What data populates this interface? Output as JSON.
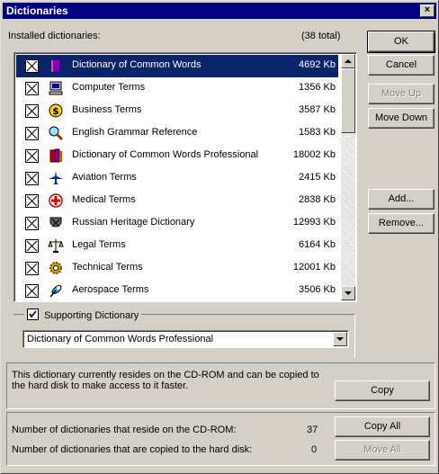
{
  "window": {
    "title": "Dictionaries",
    "close_label": "×"
  },
  "header": {
    "installed_label": "Installed dictionaries:",
    "total": "(38 total)"
  },
  "dictionaries": [
    {
      "name": "Dictionary of Common Words",
      "size": "4692 Kb",
      "icon": "book-icon",
      "checked": true,
      "selected": true
    },
    {
      "name": "Computer Terms",
      "size": "1356 Kb",
      "icon": "computer-icon",
      "checked": true
    },
    {
      "name": "Business Terms",
      "size": "3587 Kb",
      "icon": "dollar-icon",
      "checked": true
    },
    {
      "name": "English Grammar Reference",
      "size": "1583 Kb",
      "icon": "magnifier-icon",
      "checked": true
    },
    {
      "name": "Dictionary of Common Words Professional",
      "size": "18002 Kb",
      "icon": "books-icon",
      "checked": true
    },
    {
      "name": "Aviation Terms",
      "size": "2415 Kb",
      "icon": "airplane-icon",
      "checked": true
    },
    {
      "name": "Medical Terms",
      "size": "2838 Kb",
      "icon": "medical-cross-icon",
      "checked": true
    },
    {
      "name": "Russian Heritage Dictionary",
      "size": "12993 Kb",
      "icon": "crest-icon",
      "checked": true
    },
    {
      "name": "Legal Terms",
      "size": "6164 Kb",
      "icon": "scales-icon",
      "checked": true
    },
    {
      "name": "Technical Terms",
      "size": "12001 Kb",
      "icon": "gear-icon",
      "checked": true
    },
    {
      "name": "Aerospace Terms",
      "size": "3506 Kb",
      "icon": "satellite-icon",
      "checked": true
    }
  ],
  "buttons": {
    "ok": "OK",
    "cancel": "Cancel",
    "move_up": "Move Up",
    "move_down": "Move Down",
    "add": "Add...",
    "remove": "Remove...",
    "copy": "Copy",
    "copy_all": "Copy All",
    "move_all": "Move All"
  },
  "supporting": {
    "label": "Supporting Dictionary",
    "checked": true,
    "selected": "Dictionary of Common Words Professional"
  },
  "info": {
    "text_line1": "This dictionary currently resides on the CD-ROM and can be copied to",
    "text_line2": "the hard disk to make access to it faster."
  },
  "stats": {
    "cdrom_label": "Number of dictionaries that reside on the CD-ROM:",
    "cdrom_count": "37",
    "hd_label": "Number of dictionaries that are copied to the hard disk:",
    "hd_count": "0"
  },
  "colors": {
    "title_bar": "#000080",
    "selection": "#0a246a",
    "face": "#d4d0c8"
  }
}
